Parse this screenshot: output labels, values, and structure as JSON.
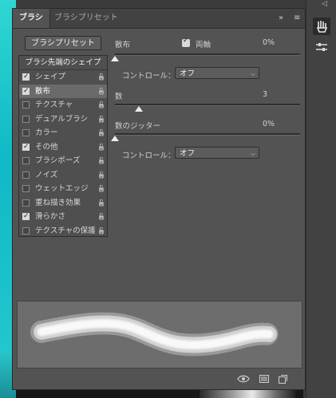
{
  "tabs": [
    {
      "label": "ブラシ"
    },
    {
      "label": "ブラシプリセット"
    }
  ],
  "tab_controls": {
    "collapse": "»",
    "menu": "≡"
  },
  "preset_button": "ブラシプリセット",
  "list_header": "ブラシ先端のシェイプ",
  "items": [
    {
      "label": "シェイプ",
      "checked": true,
      "selected": false
    },
    {
      "label": "散布",
      "checked": true,
      "selected": true
    },
    {
      "label": "テクスチャ",
      "checked": false,
      "selected": false
    },
    {
      "label": "デュアルブラシ",
      "checked": false,
      "selected": false
    },
    {
      "label": "カラー",
      "checked": false,
      "selected": false
    },
    {
      "label": "その他",
      "checked": true,
      "selected": false
    },
    {
      "label": "ブラシポーズ",
      "checked": false,
      "selected": false
    },
    {
      "label": "ノイズ",
      "checked": false,
      "selected": false
    },
    {
      "label": "ウェットエッジ",
      "checked": false,
      "selected": false
    },
    {
      "label": "重ね描き効果",
      "checked": false,
      "selected": false
    },
    {
      "label": "滑らかさ",
      "checked": true,
      "selected": false
    },
    {
      "label": "テクスチャの保護",
      "checked": false,
      "selected": false
    }
  ],
  "scatter": {
    "label": "散布",
    "both_axes_label": "両軸",
    "both_axes_checked": true,
    "value": "0%",
    "level": 0,
    "control_label": "コントロール：",
    "control_value": "オフ"
  },
  "count": {
    "label": "数",
    "value": "3",
    "level": 0.13
  },
  "count_jitter": {
    "label": "数のジッター",
    "value": "0%",
    "level": 0,
    "control_label": "コントロール：",
    "control_value": "オフ"
  },
  "icons": {
    "lock": "lock-icon",
    "chevron": "chevron-down-icon",
    "eye": "eye-icon",
    "grid": "grid-icon",
    "new": "new-preset-icon"
  }
}
